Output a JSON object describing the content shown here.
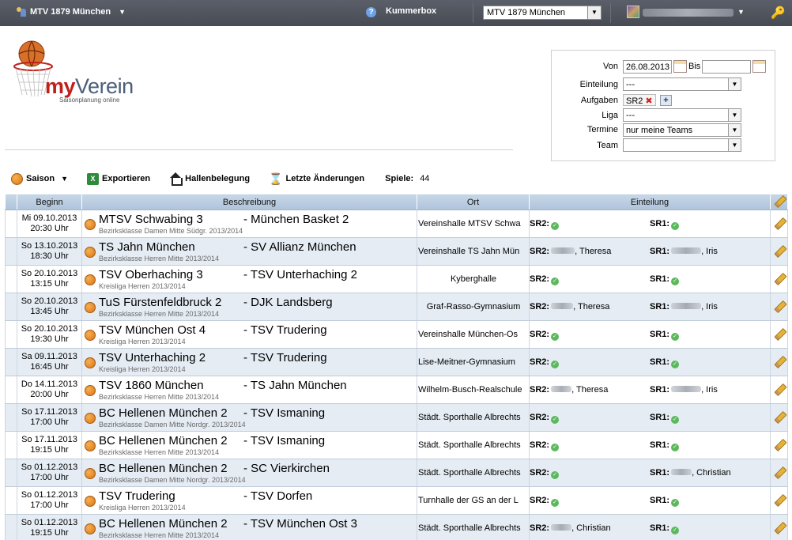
{
  "topbar": {
    "club_name": "MTV 1879 München",
    "help_symbol": "?",
    "kummerbox_label": "Kummerbox",
    "club_select_value": "MTV 1879 München"
  },
  "logo": {
    "my": "my",
    "verein": "Verein",
    "subtitle": "Saisonplanung online"
  },
  "filter": {
    "von_label": "Von",
    "von_value": "26.08.2013",
    "bis_label": "Bis",
    "bis_value": "",
    "einteilung_label": "Einteilung",
    "einteilung_value": "---",
    "aufgaben_label": "Aufgaben",
    "aufgaben_tag": "SR2",
    "liga_label": "Liga",
    "liga_value": "---",
    "termine_label": "Termine",
    "termine_value": "nur meine Teams",
    "team_label": "Team",
    "team_value": ""
  },
  "toolbar": {
    "saison_label": "Saison",
    "export_label": "Exportieren",
    "hallen_label": "Hallenbelegung",
    "changes_label": "Letzte Änderungen",
    "games_label": "Spiele:",
    "games_count": "44"
  },
  "table": {
    "headers": {
      "beginn": "Beginn",
      "beschreibung": "Beschreibung",
      "ort": "Ort",
      "einteilung": "Einteilung"
    },
    "sr2_label": "SR2:",
    "sr1_label": "SR1:",
    "rows": [
      {
        "date": "Mi 09.10.2013",
        "time": "20:30 Uhr",
        "home": "MTSV Schwabing 3",
        "away": "- München Basket 2",
        "league": "Bezirksklasse Damen Mitte Südgr. 2013/2014",
        "venue": "Vereinshalle MTSV Schwa",
        "sr2_name": "",
        "sr1_name": ""
      },
      {
        "date": "So 13.10.2013",
        "time": "18:30 Uhr",
        "home": "TS Jahn München",
        "away": "- SV Allianz München",
        "league": "Bezirksklasse Herren Mitte 2013/2014",
        "venue": "Vereinshalle TS Jahn Mün",
        "sr2_name": ", Theresa",
        "sr1_name": ", Iris"
      },
      {
        "date": "So 20.10.2013",
        "time": "13:15 Uhr",
        "home": "TSV Oberhaching 3",
        "away": "- TSV Unterhaching 2",
        "league": "Kreisliga Herren 2013/2014",
        "venue": "Kyberghalle",
        "sr2_name": "",
        "sr1_name": ""
      },
      {
        "date": "So 20.10.2013",
        "time": "13:45 Uhr",
        "home": "TuS Fürstenfeldbruck 2",
        "away": "- DJK Landsberg",
        "league": "Bezirksklasse Herren Mitte 2013/2014",
        "venue": "Graf-Rasso-Gymnasium",
        "sr2_name": ", Theresa",
        "sr1_name": ", Iris"
      },
      {
        "date": "So 20.10.2013",
        "time": "19:30 Uhr",
        "home": "TSV München Ost 4",
        "away": "- TSV Trudering",
        "league": "Kreisliga Herren 2013/2014",
        "venue": "Vereinshalle München-Os",
        "sr2_name": "",
        "sr1_name": ""
      },
      {
        "date": "Sa 09.11.2013",
        "time": "16:45 Uhr",
        "home": "TSV Unterhaching 2",
        "away": "- TSV Trudering",
        "league": "Kreisliga Herren 2013/2014",
        "venue": "Lise-Meitner-Gymnasium",
        "sr2_name": "",
        "sr1_name": ""
      },
      {
        "date": "Do 14.11.2013",
        "time": "20:00 Uhr",
        "home": "TSV 1860 München",
        "away": "- TS Jahn München",
        "league": "Bezirksklasse Herren Mitte 2013/2014",
        "venue": "Wilhelm-Busch-Realschule",
        "sr2_name": ", Theresa",
        "sr1_name": ", Iris"
      },
      {
        "date": "So 17.11.2013",
        "time": "17:00 Uhr",
        "home": "BC Hellenen München 2",
        "away": "- TSV Ismaning",
        "league": "Bezirksklasse Damen Mitte Nordgr. 2013/2014",
        "venue": "Städt. Sporthalle Albrechts",
        "sr2_name": "",
        "sr1_name": ""
      },
      {
        "date": "So 17.11.2013",
        "time": "19:15 Uhr",
        "home": "BC Hellenen München 2",
        "away": "- TSV Ismaning",
        "league": "Bezirksklasse Herren Mitte 2013/2014",
        "venue": "Städt. Sporthalle Albrechts",
        "sr2_name": "",
        "sr1_name": ""
      },
      {
        "date": "So 01.12.2013",
        "time": "17:00 Uhr",
        "home": "BC Hellenen München 2",
        "away": "- SC Vierkirchen",
        "league": "Bezirksklasse Damen Mitte Nordgr. 2013/2014",
        "venue": "Städt. Sporthalle Albrechts",
        "sr2_name": "",
        "sr1_name": ", Christian"
      },
      {
        "date": "So 01.12.2013",
        "time": "17:00 Uhr",
        "home": "TSV Trudering",
        "away": "- TSV Dorfen",
        "league": "Kreisliga Herren 2013/2014",
        "venue": "Turnhalle der GS an der L",
        "sr2_name": "",
        "sr1_name": ""
      },
      {
        "date": "So 01.12.2013",
        "time": "19:15 Uhr",
        "home": "BC Hellenen München 2",
        "away": "- TSV München Ost 3",
        "league": "Bezirksklasse Herren Mitte 2013/2014",
        "venue": "Städt. Sporthalle Albrechts",
        "sr2_name": ", Christian",
        "sr1_name": ""
      }
    ]
  },
  "colors": {
    "topbar": "#4f535c",
    "header": "#b9cce0",
    "row_alt": "#e5ecf4",
    "brand_red": "#c0201a",
    "brand_blue": "#4a5f7a",
    "ok_green": "#5cb85c"
  },
  "icons": [
    "club-users-icon",
    "help-icon",
    "key-icon",
    "basketball-icon",
    "excel-icon",
    "house-icon",
    "hourglass-icon",
    "pencil-icon",
    "check-icon",
    "calendar-icon"
  ]
}
